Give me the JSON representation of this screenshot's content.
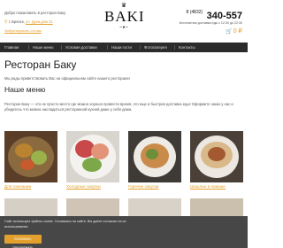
{
  "header": {
    "welcome": "Добро пожаловать в ресторан Баку",
    "city": "г. Брянск,",
    "street": "ул. Дуки,дом 31",
    "booking_link": "Забронировать столик",
    "logo_text": "BAKI",
    "phone_code": "8 (4832)",
    "phone_number": "340-557",
    "hours": "Бесплатная доставка еды с 12:00 до 22:30",
    "cart_total": "0 ₽",
    "accent_color": "#e3a02c"
  },
  "nav": {
    "items": [
      {
        "label": "Главная"
      },
      {
        "label": "Наше меню"
      },
      {
        "label": "Условия доставки"
      },
      {
        "label": "Наши гости"
      },
      {
        "label": "Фотогалерея"
      },
      {
        "label": "Контакты"
      }
    ]
  },
  "main": {
    "title": "Ресторан Баку",
    "intro": "Мы рады приветствовать Вас на официальном сайте нашего ресторана!",
    "menu_title": "Наше меню",
    "description": "Ресторан Баку — это не просто место где можно хорошо провести время, это еще и быстрая доставка еды! Оформите заказ у нас и убедитесь что можно насладиться ресторанной кухней даже у себя дома.",
    "cards": [
      {
        "label": "Для компании",
        "icon": "company-platter-photo"
      },
      {
        "label": "Холодные закуски",
        "icon": "cold-appetizers-photo"
      },
      {
        "label": "Горячие закуски",
        "icon": "hot-appetizers-photo"
      },
      {
        "label": "Шашлык в лаваше",
        "icon": "shashlik-photo"
      }
    ]
  },
  "cookie": {
    "text": "Сайт использует файлы cookie. Оставаясь на сайте, Вы даете согласие на их использование.",
    "button": "Согласен, продолжить"
  }
}
